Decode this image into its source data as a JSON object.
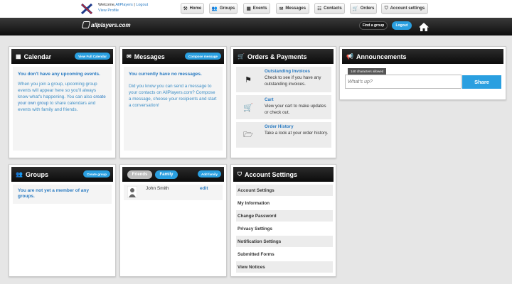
{
  "topbar": {
    "welcome_prefix": "Welcome,",
    "username": "AllPlayers",
    "separator": "|",
    "logout_link": "Logout",
    "view_profile": "View Profile",
    "nav": [
      {
        "label": "Home",
        "icon": "wrench-icon"
      },
      {
        "label": "Groups",
        "icon": "users-icon"
      },
      {
        "label": "Events",
        "icon": "calendar-icon"
      },
      {
        "label": "Messages",
        "icon": "envelope-icon"
      },
      {
        "label": "Contacts",
        "icon": "contacts-icon"
      },
      {
        "label": "Orders",
        "icon": "cart-icon"
      },
      {
        "label": "Account settings",
        "icon": "shield-icon"
      }
    ]
  },
  "header": {
    "brand": "allplayers.com",
    "find_group": "Find a group",
    "logout": "Logout"
  },
  "calendar": {
    "title": "Calendar",
    "action": "View Full Calendar",
    "lead": "You don't have any upcoming events.",
    "text1": "When you join a group, upcoming group events will appear here so you'll always know what's happening. You can also ",
    "link": "create your own group",
    "text2": " to share calendars and events with family and friends."
  },
  "messages": {
    "title": "Messages",
    "action": "Compose message",
    "lead": "You currently have no messages.",
    "text": "Did you know you can send a message to your contacts on AllPlayers.com? Compose a message, choose your recipients and start a conversation!"
  },
  "orders": {
    "title": "Orders & Payments",
    "items": [
      {
        "title": "Outstanding Invoices",
        "text": "Check to see if you have any outstanding invoices."
      },
      {
        "title": "Cart",
        "text": "View your cart to make updates or check out."
      },
      {
        "title": "Order History",
        "text": "Take a look at your order history."
      }
    ]
  },
  "announcements": {
    "title": "Announcements",
    "counter": "140 characters allowed",
    "placeholder": "What's up?",
    "share": "Share"
  },
  "groups": {
    "title": "Groups",
    "action": "Create group",
    "lead": "You are not yet a member of any groups."
  },
  "friends": {
    "tab_friends": "Friends",
    "tab_family": "Family",
    "action": "Add family",
    "member_name": "John Smith",
    "edit": "edit"
  },
  "account": {
    "title": "Account Settings",
    "items": [
      "Account Settings",
      "My Information",
      "Change Password",
      "Privacy Settings",
      "Notification Settings",
      "Submitted Forms",
      "View Notices"
    ]
  },
  "colors": {
    "accent": "#2a9fe0",
    "link": "#2a7bc2",
    "dark_header": "#1a1a1a"
  }
}
